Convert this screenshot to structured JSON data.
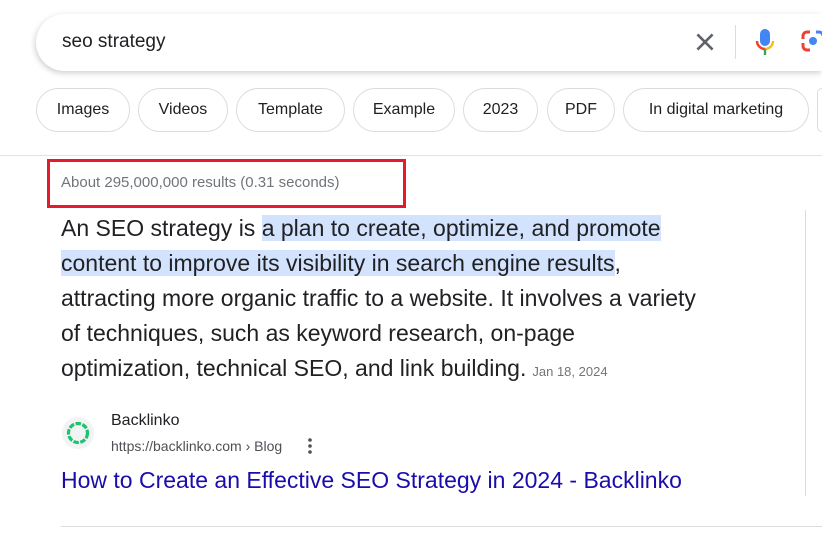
{
  "search": {
    "query": "seo strategy",
    "icons": [
      "clear-icon",
      "microphone-icon",
      "google-lens-icon"
    ]
  },
  "chips": [
    "Images",
    "Videos",
    "Template",
    "Example",
    "2023",
    "PDF",
    "In digital marketing"
  ],
  "results_stats": "About 295,000,000 results (0.31 seconds)",
  "highlight_box_color": "#e8192c",
  "snippet": {
    "lines": [
      [
        "An SEO strategy is ",
        "a plan to create, optimize, and promote"
      ],
      [
        "",
        "content to improve its visibility in search engine results",
        ","
      ],
      [
        "attracting more organic traffic to a website. It involves a variety"
      ],
      [
        "of techniques, such as keyword research, on-page"
      ],
      [
        "optimization, technical SEO, and link building."
      ]
    ],
    "date": "Jan 18, 2024",
    "highlight_color": "#d3e3fd"
  },
  "source": {
    "site_name": "Backlinko",
    "url": "https://backlinko.com › Blog",
    "title": "How to Create an Effective SEO Strategy in 2024 - Backlinko",
    "link_color": "#1a0dab"
  }
}
